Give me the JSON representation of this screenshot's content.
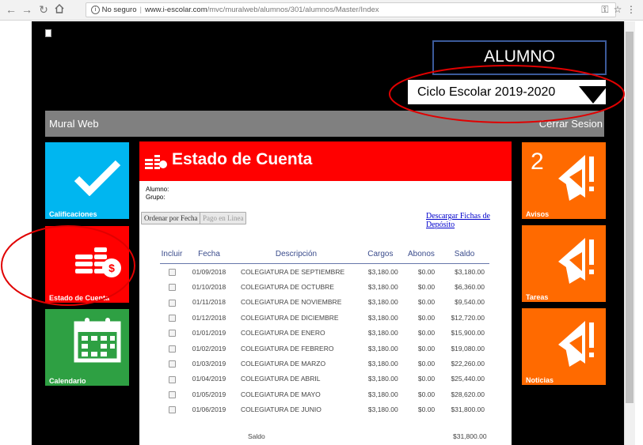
{
  "browser": {
    "security_label": "No seguro",
    "url_domain": "www.i-escolar.com",
    "url_path": "/mvc/muralweb/alumnos/301/alumnos/Master/Index"
  },
  "header": {
    "role": "ALUMNO",
    "ciclo_label": "Ciclo Escolar  2019-2020"
  },
  "topbar": {
    "brand": "Mural Web",
    "logout": "Cerrar Sesion"
  },
  "left_tiles": [
    {
      "label": "Calificaciones",
      "color": "#00b6f0"
    },
    {
      "label": "Estado de Cuenta",
      "color": "#ff0000"
    },
    {
      "label": "Calendario",
      "color": "#2ea043"
    }
  ],
  "right_tiles": [
    {
      "label": "Avisos",
      "count": "2",
      "color": "#ff6a00"
    },
    {
      "label": "Tareas",
      "color": "#ff6a00"
    },
    {
      "label": "Noticias",
      "color": "#ff6a00"
    }
  ],
  "main": {
    "title": "Estado de Cuenta",
    "alumno_label": "Alumno:",
    "grupo_label": "Grupo:",
    "btn_ordenar": "Ordenar por Fecha",
    "btn_pago": "Pago en Linea",
    "download_link": "Descargar Fichas de Depósito",
    "columns": [
      "Incluir",
      "Fecha",
      "Descripción",
      "Cargos",
      "Abonos",
      "Saldo"
    ],
    "rows": [
      {
        "fecha": "01/09/2018",
        "desc": "COLEGIATURA DE SEPTIEMBRE",
        "cargos": "$3,180.00",
        "abonos": "$0.00",
        "saldo": "$3,180.00"
      },
      {
        "fecha": "01/10/2018",
        "desc": "COLEGIATURA DE OCTUBRE",
        "cargos": "$3,180.00",
        "abonos": "$0.00",
        "saldo": "$6,360.00"
      },
      {
        "fecha": "01/11/2018",
        "desc": "COLEGIATURA DE NOVIEMBRE",
        "cargos": "$3,180.00",
        "abonos": "$0.00",
        "saldo": "$9,540.00"
      },
      {
        "fecha": "01/12/2018",
        "desc": "COLEGIATURA DE DICIEMBRE",
        "cargos": "$3,180.00",
        "abonos": "$0.00",
        "saldo": "$12,720.00"
      },
      {
        "fecha": "01/01/2019",
        "desc": "COLEGIATURA DE ENERO",
        "cargos": "$3,180.00",
        "abonos": "$0.00",
        "saldo": "$15,900.00"
      },
      {
        "fecha": "01/02/2019",
        "desc": "COLEGIATURA DE FEBRERO",
        "cargos": "$3,180.00",
        "abonos": "$0.00",
        "saldo": "$19,080.00"
      },
      {
        "fecha": "01/03/2019",
        "desc": "COLEGIATURA DE MARZO",
        "cargos": "$3,180.00",
        "abonos": "$0.00",
        "saldo": "$22,260.00"
      },
      {
        "fecha": "01/04/2019",
        "desc": "COLEGIATURA DE ABRIL",
        "cargos": "$3,180.00",
        "abonos": "$0.00",
        "saldo": "$25,440.00"
      },
      {
        "fecha": "01/05/2019",
        "desc": "COLEGIATURA DE MAYO",
        "cargos": "$3,180.00",
        "abonos": "$0.00",
        "saldo": "$28,620.00"
      },
      {
        "fecha": "01/06/2019",
        "desc": "COLEGIATURA DE JUNIO",
        "cargos": "$3,180.00",
        "abonos": "$0.00",
        "saldo": "$31,800.00"
      }
    ],
    "saldo_label": "Saldo",
    "saldo_total": "$31,800.00"
  },
  "annotations": {
    "circle_color": "#e00000"
  }
}
